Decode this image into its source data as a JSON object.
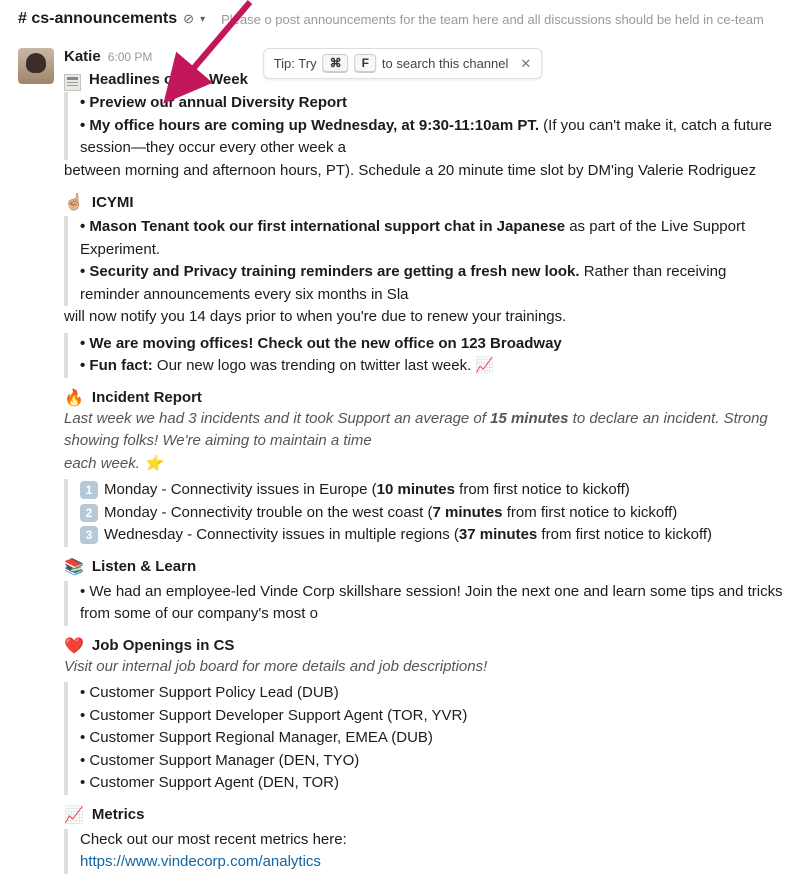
{
  "channel": {
    "name": "# cs-announcements",
    "meta_icon": "⊘",
    "topic": "Please o      post announcements for the team here and all discussions should be held in ce-team"
  },
  "tip": {
    "prefix": "Tip: Try",
    "key1": "⌘",
    "key2": "F",
    "suffix": "to search this channel"
  },
  "message": {
    "author": "Katie",
    "time": "6:00 PM"
  },
  "headlines": {
    "title": "Headlines of the Week",
    "item1_b": "• Preview our annual Diversity Report",
    "item2_b": "• My office hours are coming up Wednesday, at 9:30-11:10am PT.",
    "item2_rest": " (If you can't make it, catch a future session—they occur every other week a",
    "item2_line2": "between morning and afternoon hours, PT). Schedule a 20 minute time slot by DM'ing Valerie Rodriguez"
  },
  "icymi": {
    "emoji": "☝🏼",
    "title": "ICYMI",
    "i1_b": "• Mason Tenant took our first international support chat in Japanese",
    "i1_rest": " as part of the Live Support Experiment.",
    "i2_b": "• Security and Privacy training reminders are getting a fresh new look.",
    "i2_rest": " Rather than receiving reminder announcements every six months in Sla",
    "i2_line2": "will now notify you 14 days prior to when you're due to renew your trainings.",
    "i3_b": "• We are moving offices! Check out the new office on 123 Broadway",
    "i4_b": "• Fun fact:",
    "i4_rest": " Our new logo was trending on twitter last week. 📈"
  },
  "incident": {
    "emoji": "🔥",
    "title": "Incident Report",
    "intro_a": "Last week we had 3 incidents and it took Support an average of ",
    "intro_b": "15 minutes",
    "intro_c": " to declare an incident. Strong showing folks! We're aiming to maintain a time",
    "intro_line2": "each week. ⭐",
    "r1_num": "1",
    "r1_a": "Monday - Connectivity issues in Europe (",
    "r1_b": "10 minutes",
    "r1_c": " from first notice to kickoff)",
    "r2_num": "2",
    "r2_a": "Monday - Connectivity trouble on the west coast (",
    "r2_b": "7 minutes",
    "r2_c": " from first notice to kickoff)",
    "r3_num": "3",
    "r3_a": "Wednesday - Connectivity issues in multiple regions (",
    "r3_b": "37 minutes",
    "r3_c": " from first notice to kickoff)"
  },
  "listen": {
    "emoji": "📚",
    "title": "Listen & Learn",
    "line": "• We had an employee-led Vinde Corp skillshare session! Join the next one and learn some tips and tricks from some of our company's most o"
  },
  "jobs": {
    "emoji": "❤️",
    "title": "Job Openings in CS",
    "intro": "Visit our internal job board for more details and job descriptions!",
    "j1": "• Customer Support Policy Lead (DUB)",
    "j2": "• Customer Support Developer Support Agent (TOR, YVR)",
    "j3": "• Customer Support Regional Manager, EMEA (DUB)",
    "j4": "• Customer Support Manager (DEN, TYO)",
    "j5": "• Customer Support Agent (DEN, TOR)"
  },
  "metrics": {
    "emoji": "📈",
    "title": "Metrics",
    "line": "Check out our most recent metrics here:",
    "link": "https://www.vindecorp.com/analytics"
  }
}
